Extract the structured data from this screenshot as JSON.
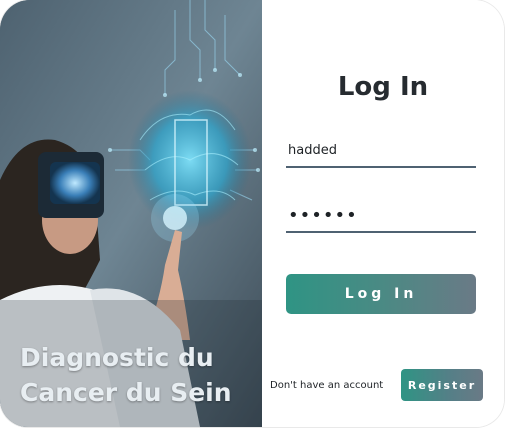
{
  "hero": {
    "caption_line1": "Diagnostic du",
    "caption_line2": "Cancer du Sein"
  },
  "form": {
    "title": "Log In",
    "username_value": "hadded",
    "password_value": "••••••",
    "login_label": "Log In",
    "account_prompt": "Don't have an account",
    "register_label": "Register"
  },
  "colors": {
    "accent_start": "#2f9484",
    "accent_end": "#6a7a86",
    "field_underline": "#4f6272",
    "title_text": "#262b30"
  }
}
